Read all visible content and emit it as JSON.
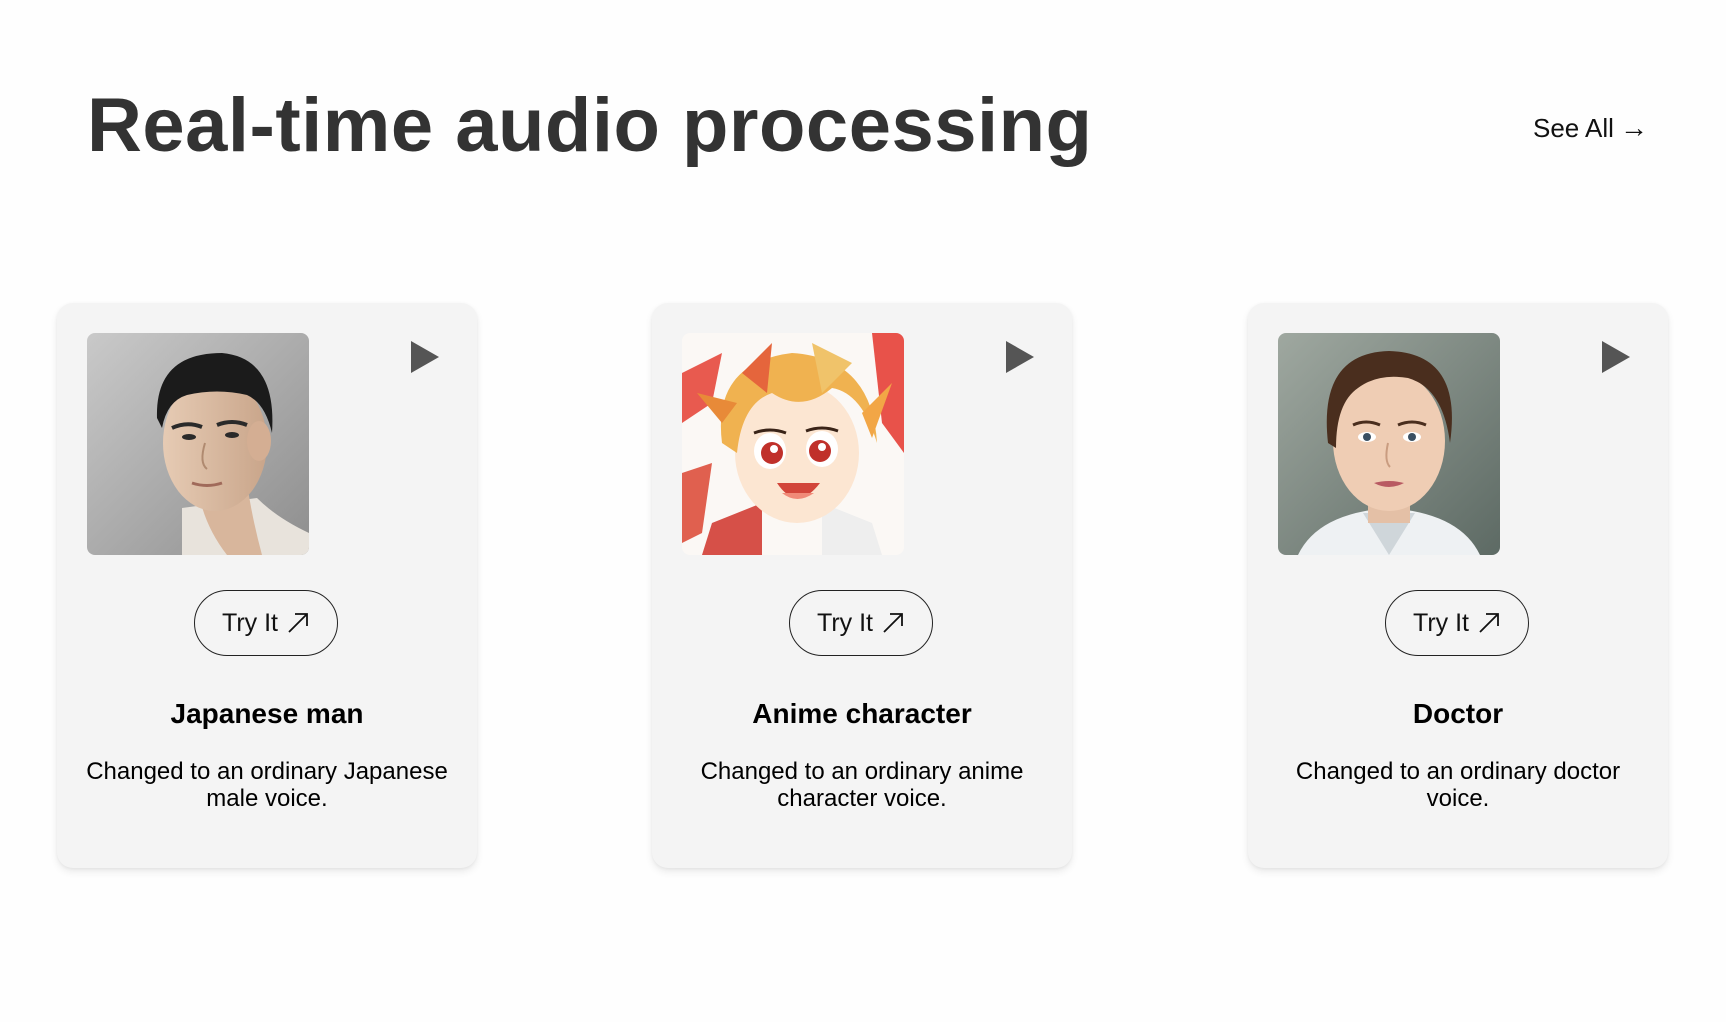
{
  "header": {
    "title": "Real-time audio processing",
    "see_all_label": "See All",
    "see_all_arrow": "→"
  },
  "cards": [
    {
      "image": "japanese-man-portrait",
      "play_icon": "play-icon",
      "try_label": "Try It",
      "try_icon": "external-arrow-icon",
      "title": "Japanese man",
      "description": "Changed to an ordinary Japanese male voice."
    },
    {
      "image": "anime-character-portrait",
      "play_icon": "play-icon",
      "try_label": "Try It",
      "try_icon": "external-arrow-icon",
      "title": "Anime character",
      "description": "Changed to an ordinary anime character voice."
    },
    {
      "image": "doctor-portrait",
      "play_icon": "play-icon",
      "try_label": "Try It",
      "try_icon": "external-arrow-icon",
      "title": "Doctor",
      "description": "Changed to an ordinary doctor voice."
    }
  ],
  "colors": {
    "card_background": "#f4f4f4",
    "title_color": "#333333",
    "play_icon": "#555555"
  }
}
